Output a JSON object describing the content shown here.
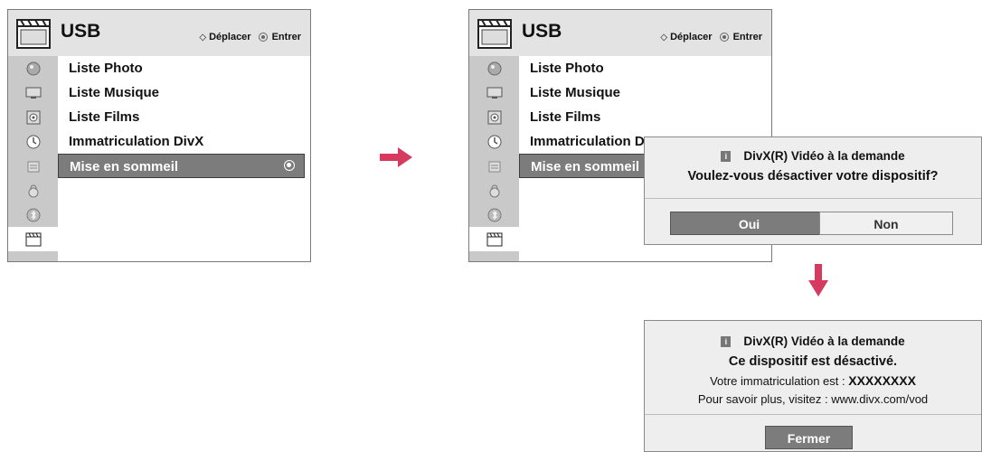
{
  "menu_screen": {
    "title": "USB",
    "hint_move": "Déplacer",
    "hint_enter": "Entrer",
    "items": [
      {
        "label": "Liste Photo"
      },
      {
        "label": "Liste Musique"
      },
      {
        "label": "Liste Films"
      },
      {
        "label": "Immatriculation DivX"
      },
      {
        "label": "Mise en sommeil"
      }
    ],
    "selected_item": "Mise en sommeil",
    "side_icons": [
      "photo-icon",
      "tv-icon",
      "speaker-icon",
      "clock-icon",
      "lock-box-icon",
      "padlock-icon",
      "bluetooth-icon",
      "clapperboard-icon"
    ],
    "truncated_item_4": "Immatriculation D",
    "truncated_item_5": "Mise en sommeil"
  },
  "dialog_confirm": {
    "title": "DivX(R) Vidéo à la demande",
    "question": "Voulez-vous désactiver votre dispositif?",
    "yes_label": "Oui",
    "no_label": "Non"
  },
  "dialog_result": {
    "title": "DivX(R) Vidéo à la demande",
    "message": "Ce dispositif est désactivé.",
    "reg_label": "Votre immatriculation est : ",
    "reg_code": "XXXXXXXX",
    "more_info": "Pour savoir plus, visitez : www.divx.com/vod",
    "close_label": "Fermer"
  },
  "info_glyph": "i",
  "colors": {
    "accent_arrow": "#d63a5e",
    "highlight": "#7c7c7c",
    "panel_bg": "#e9e9e9"
  }
}
